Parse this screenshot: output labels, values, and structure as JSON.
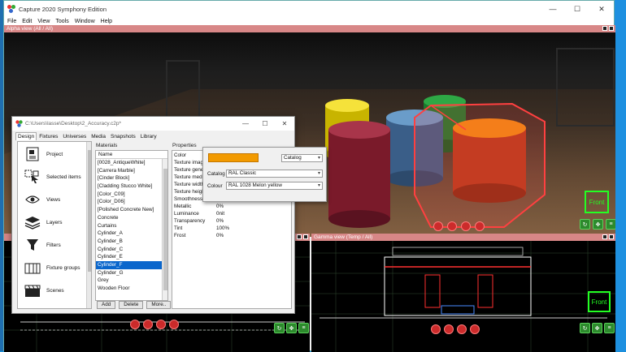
{
  "app": {
    "title": "Capture 2020 Symphony Edition",
    "menu": [
      "File",
      "Edit",
      "View",
      "Tools",
      "Window",
      "Help"
    ],
    "window_buttons": [
      "—",
      "☐",
      "✕"
    ]
  },
  "viewports": {
    "alpha": {
      "title": "Alpha view  (All / All)",
      "cube_label": "Front"
    },
    "gamma": {
      "title": "Gamma view  (Temp / All)",
      "cube_label": "Front"
    }
  },
  "dialog": {
    "title": "C:\\Users\\lasse\\Desktop\\2_Accuracy.c2p*",
    "window_buttons": [
      "—",
      "☐",
      "✕"
    ],
    "tabs": [
      "Design",
      "Fixtures",
      "Universes",
      "Media",
      "Snapshots",
      "Library"
    ],
    "active_tab": "Design",
    "sidebar": [
      {
        "label": "Project",
        "icon": "project-icon"
      },
      {
        "label": "Selected items",
        "icon": "selected-items-icon"
      },
      {
        "label": "Views",
        "icon": "eye-icon"
      },
      {
        "label": "Layers",
        "icon": "layers-icon"
      },
      {
        "label": "Filters",
        "icon": "filter-icon"
      },
      {
        "label": "Fixture groups",
        "icon": "fixture-groups-icon"
      },
      {
        "label": "Scenes",
        "icon": "clapperboard-icon"
      }
    ],
    "materials": {
      "section_label": "Materials",
      "column_header": "Name",
      "items": [
        "[0028_AntiqueWhite]",
        "[Carrera Marble]",
        "[Cinder Block]",
        "[Cladding Stucco White]",
        "[Color_C09]",
        "[Color_D06]",
        "[Polished Concrete New]",
        "Concrete",
        "Curtains",
        "Cylinder_A",
        "Cylinder_B",
        "Cylinder_C",
        "Cylinder_E",
        "Cylinder_F",
        "Cylinder_G",
        "Grey",
        "Wooden Floor"
      ],
      "selected": "Cylinder_F",
      "buttons": {
        "add": "Add",
        "delete": "Delete",
        "more": "More.."
      }
    },
    "properties": {
      "section_label": "Properties",
      "rows": [
        {
          "key": "Color",
          "value": ""
        },
        {
          "key": "Texture image",
          "value": ""
        },
        {
          "key": "Texture generator",
          "value": ""
        },
        {
          "key": "Texture media",
          "value": ""
        },
        {
          "key": "Texture width",
          "value": ""
        },
        {
          "key": "Texture height",
          "value": ""
        },
        {
          "key": "Smoothness",
          "value": ""
        },
        {
          "key": "Metallic",
          "value": "0%"
        },
        {
          "key": "Luminance",
          "value": "0nit"
        },
        {
          "key": "Transparency",
          "value": "0%"
        },
        {
          "key": "Tint",
          "value": "100%"
        },
        {
          "key": "Frost",
          "value": "0%"
        }
      ]
    },
    "color_popup": {
      "swatch_color": "#f29a00",
      "mode_select": "Catalog",
      "catalog_label": "Catalog",
      "catalog_value": "RAL Classic",
      "colour_label": "Colour",
      "colour_value": "RAL 1028 Melon yellow"
    }
  }
}
